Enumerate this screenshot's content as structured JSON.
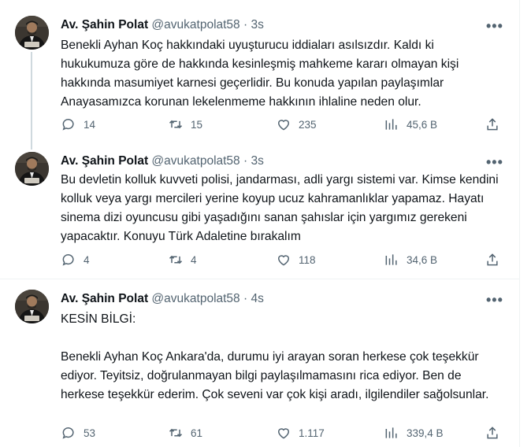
{
  "tweets": [
    {
      "name": "Av. Şahin Polat",
      "handle": "@avukatpolat58",
      "dot": "·",
      "time": "3s",
      "more": "•••",
      "text": [
        "Benekli Ayhan Koç hakkındaki uyuşturucu iddiaları asılsızdır. Kaldı ki hukukumuza göre de hakkında kesinleşmiş mahkeme kararı olmayan kişi hakkında masumiyet karnesi geçerlidir. Bu konuda yapılan paylaşımlar Anayasamızca korunan lekelenmeme hakkının ihlaline neden olur."
      ],
      "replies": "14",
      "retweets": "15",
      "likes": "235",
      "views": "45,6 B"
    },
    {
      "name": "Av. Şahin Polat",
      "handle": "@avukatpolat58",
      "dot": "·",
      "time": "3s",
      "more": "•••",
      "text": [
        "Bu devletin kolluk kuvveti polisi, jandarması, adli yargı sistemi var. Kimse kendini kolluk veya yargı mercileri yerine koyup ucuz kahramanlıklar yapamaz. Hayatı sinema dizi oyuncusu gibi yaşadığını sanan şahıslar için yargımız gerekeni yapacaktır. Konuyu Türk Adaletine bırakalım"
      ],
      "replies": "4",
      "retweets": "4",
      "likes": "118",
      "views": "34,6 B"
    },
    {
      "name": "Av. Şahin Polat",
      "handle": "@avukatpolat58",
      "dot": "·",
      "time": "4s",
      "more": "•••",
      "text": [
        "KESİN BİLGİ:",
        "Benekli Ayhan Koç Ankara'da, durumu iyi arayan soran herkese çok teşekkür ediyor. Teyitsiz, doğrulanmayan bilgi paylaşılmamasını rica ediyor. Ben de herkese teşekkür ederim. Çok seveni var çok kişi aradı, ilgilendiler sağolsunlar."
      ],
      "replies": "53",
      "retweets": "61",
      "likes": "1.117",
      "views": "339,4 B"
    }
  ]
}
